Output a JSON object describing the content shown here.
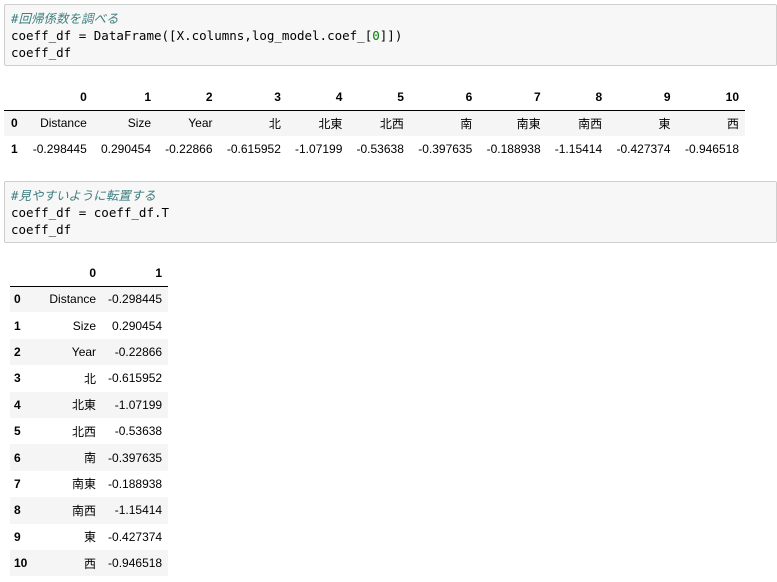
{
  "cell1": {
    "comment": "#回帰係数を調べる",
    "line2_pre": "coeff_df = DataFrame([X.columns,log_model.coef_[",
    "line2_num": "0",
    "line2_post": "]])",
    "line3": "coeff_df"
  },
  "table1": {
    "columns": [
      "0",
      "1",
      "2",
      "3",
      "4",
      "5",
      "6",
      "7",
      "8",
      "9",
      "10"
    ],
    "rows": [
      {
        "index": "0",
        "cells": [
          "Distance",
          "Size",
          "Year",
          "北",
          "北東",
          "北西",
          "南",
          "南東",
          "南西",
          "東",
          "西"
        ]
      },
      {
        "index": "1",
        "cells": [
          "-0.298445",
          "0.290454",
          "-0.22866",
          "-0.615952",
          "-1.07199",
          "-0.53638",
          "-0.397635",
          "-0.188938",
          "-1.15414",
          "-0.427374",
          "-0.946518"
        ]
      }
    ]
  },
  "cell2": {
    "comment": "#見やすいように転置する",
    "line2": "coeff_df = coeff_df.T",
    "line3": "coeff_df"
  },
  "table2": {
    "columns": [
      "0",
      "1"
    ],
    "rows": [
      {
        "index": "0",
        "cells": [
          "Distance",
          "-0.298445"
        ]
      },
      {
        "index": "1",
        "cells": [
          "Size",
          "0.290454"
        ]
      },
      {
        "index": "2",
        "cells": [
          "Year",
          "-0.22866"
        ]
      },
      {
        "index": "3",
        "cells": [
          "北",
          "-0.615952"
        ]
      },
      {
        "index": "4",
        "cells": [
          "北東",
          "-1.07199"
        ]
      },
      {
        "index": "5",
        "cells": [
          "北西",
          "-0.53638"
        ]
      },
      {
        "index": "6",
        "cells": [
          "南",
          "-0.397635"
        ]
      },
      {
        "index": "7",
        "cells": [
          "南東",
          "-0.188938"
        ]
      },
      {
        "index": "8",
        "cells": [
          "南西",
          "-1.15414"
        ]
      },
      {
        "index": "9",
        "cells": [
          "東",
          "-0.427374"
        ]
      },
      {
        "index": "10",
        "cells": [
          "西",
          "-0.946518"
        ]
      }
    ]
  }
}
